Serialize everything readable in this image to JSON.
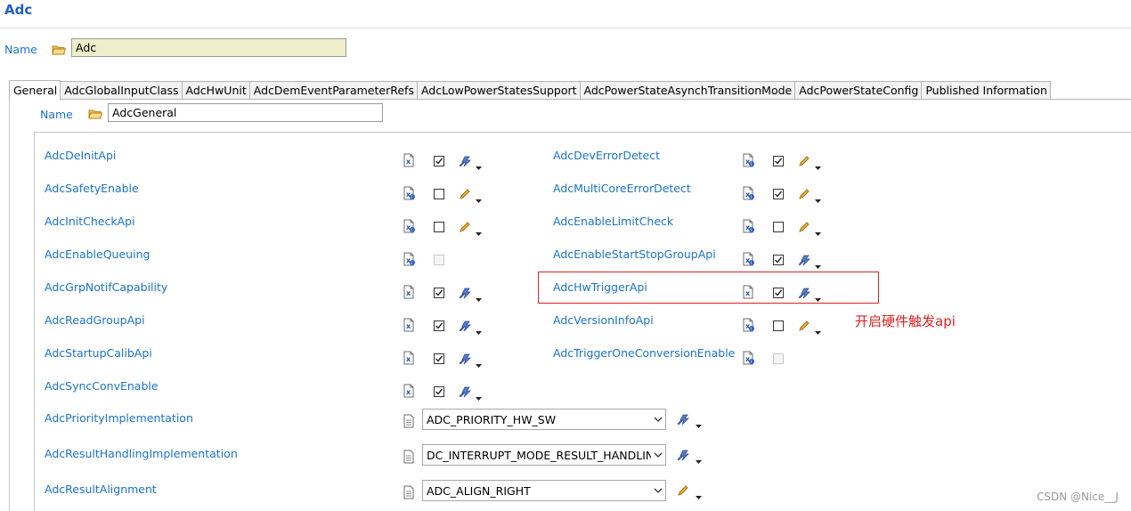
{
  "page": {
    "title": "Adc"
  },
  "name_field": {
    "label": "Name",
    "value": "Adc"
  },
  "tabs": [
    {
      "label": "General",
      "active": true
    },
    {
      "label": "AdcGlobalInputClass"
    },
    {
      "label": "AdcHwUnit"
    },
    {
      "label": "AdcDemEventParameterRefs"
    },
    {
      "label": "AdcLowPowerStatesSupport"
    },
    {
      "label": "AdcPowerStateAsynchTransitionMode"
    },
    {
      "label": "AdcPowerStateConfig"
    },
    {
      "label": "Published Information"
    }
  ],
  "general": {
    "name_label": "Name",
    "name_value": "AdcGeneral"
  },
  "left_params": [
    {
      "label": "AdcDeInitApi",
      "checked": true,
      "enabled": true,
      "tool": "wand-icon"
    },
    {
      "label": "AdcSafetyEnable",
      "checked": false,
      "enabled": true,
      "tool": "pencil-icon"
    },
    {
      "label": "AdcInitCheckApi",
      "checked": false,
      "enabled": true,
      "tool": "pencil-icon"
    },
    {
      "label": "AdcEnableQueuing",
      "checked": false,
      "enabled": false,
      "tool": ""
    },
    {
      "label": "AdcGrpNotifCapability",
      "checked": true,
      "enabled": true,
      "tool": "wand-icon"
    },
    {
      "label": "AdcReadGroupApi",
      "checked": true,
      "enabled": true,
      "tool": "wand-icon"
    },
    {
      "label": "AdcStartupCalibApi",
      "checked": true,
      "enabled": true,
      "tool": "wand-icon"
    },
    {
      "label": "AdcSyncConvEnable",
      "checked": true,
      "enabled": true,
      "tool": "wand-icon"
    }
  ],
  "right_params": [
    {
      "label": "AdcDevErrorDetect",
      "checked": true,
      "enabled": true,
      "tool": "pencil-icon"
    },
    {
      "label": "AdcMultiCoreErrorDetect",
      "checked": true,
      "enabled": true,
      "tool": "pencil-icon"
    },
    {
      "label": "AdcEnableLimitCheck",
      "checked": false,
      "enabled": true,
      "tool": "pencil-icon"
    },
    {
      "label": "AdcEnableStartStopGroupApi",
      "checked": true,
      "enabled": true,
      "tool": "wand-icon"
    },
    {
      "label": "AdcHwTriggerApi",
      "checked": true,
      "enabled": true,
      "tool": "wand-icon"
    },
    {
      "label": "AdcVersionInfoApi",
      "checked": false,
      "enabled": true,
      "tool": "pencil-icon"
    },
    {
      "label": "AdcTriggerOneConversionEnable",
      "checked": false,
      "enabled": false,
      "tool": ""
    }
  ],
  "enum_params": [
    {
      "label": "AdcPriorityImplementation",
      "value": "ADC_PRIORITY_HW_SW",
      "tool": "wand-icon"
    },
    {
      "label": "AdcResultHandlingImplementation",
      "value": "DC_INTERRUPT_MODE_RESULT_HANDLING",
      "tool": "wand-icon"
    },
    {
      "label": "AdcResultAlignment",
      "value": "ADC_ALIGN_RIGHT",
      "tool": "pencil-icon"
    }
  ],
  "annotation": {
    "text": "开启硬件触发api",
    "color": "#e02020"
  },
  "watermark": "CSDN @Nice__J",
  "colors": {
    "label_blue": "#1a73c9",
    "title_blue": "#1f5fbf",
    "highlight_red": "#e02020"
  }
}
